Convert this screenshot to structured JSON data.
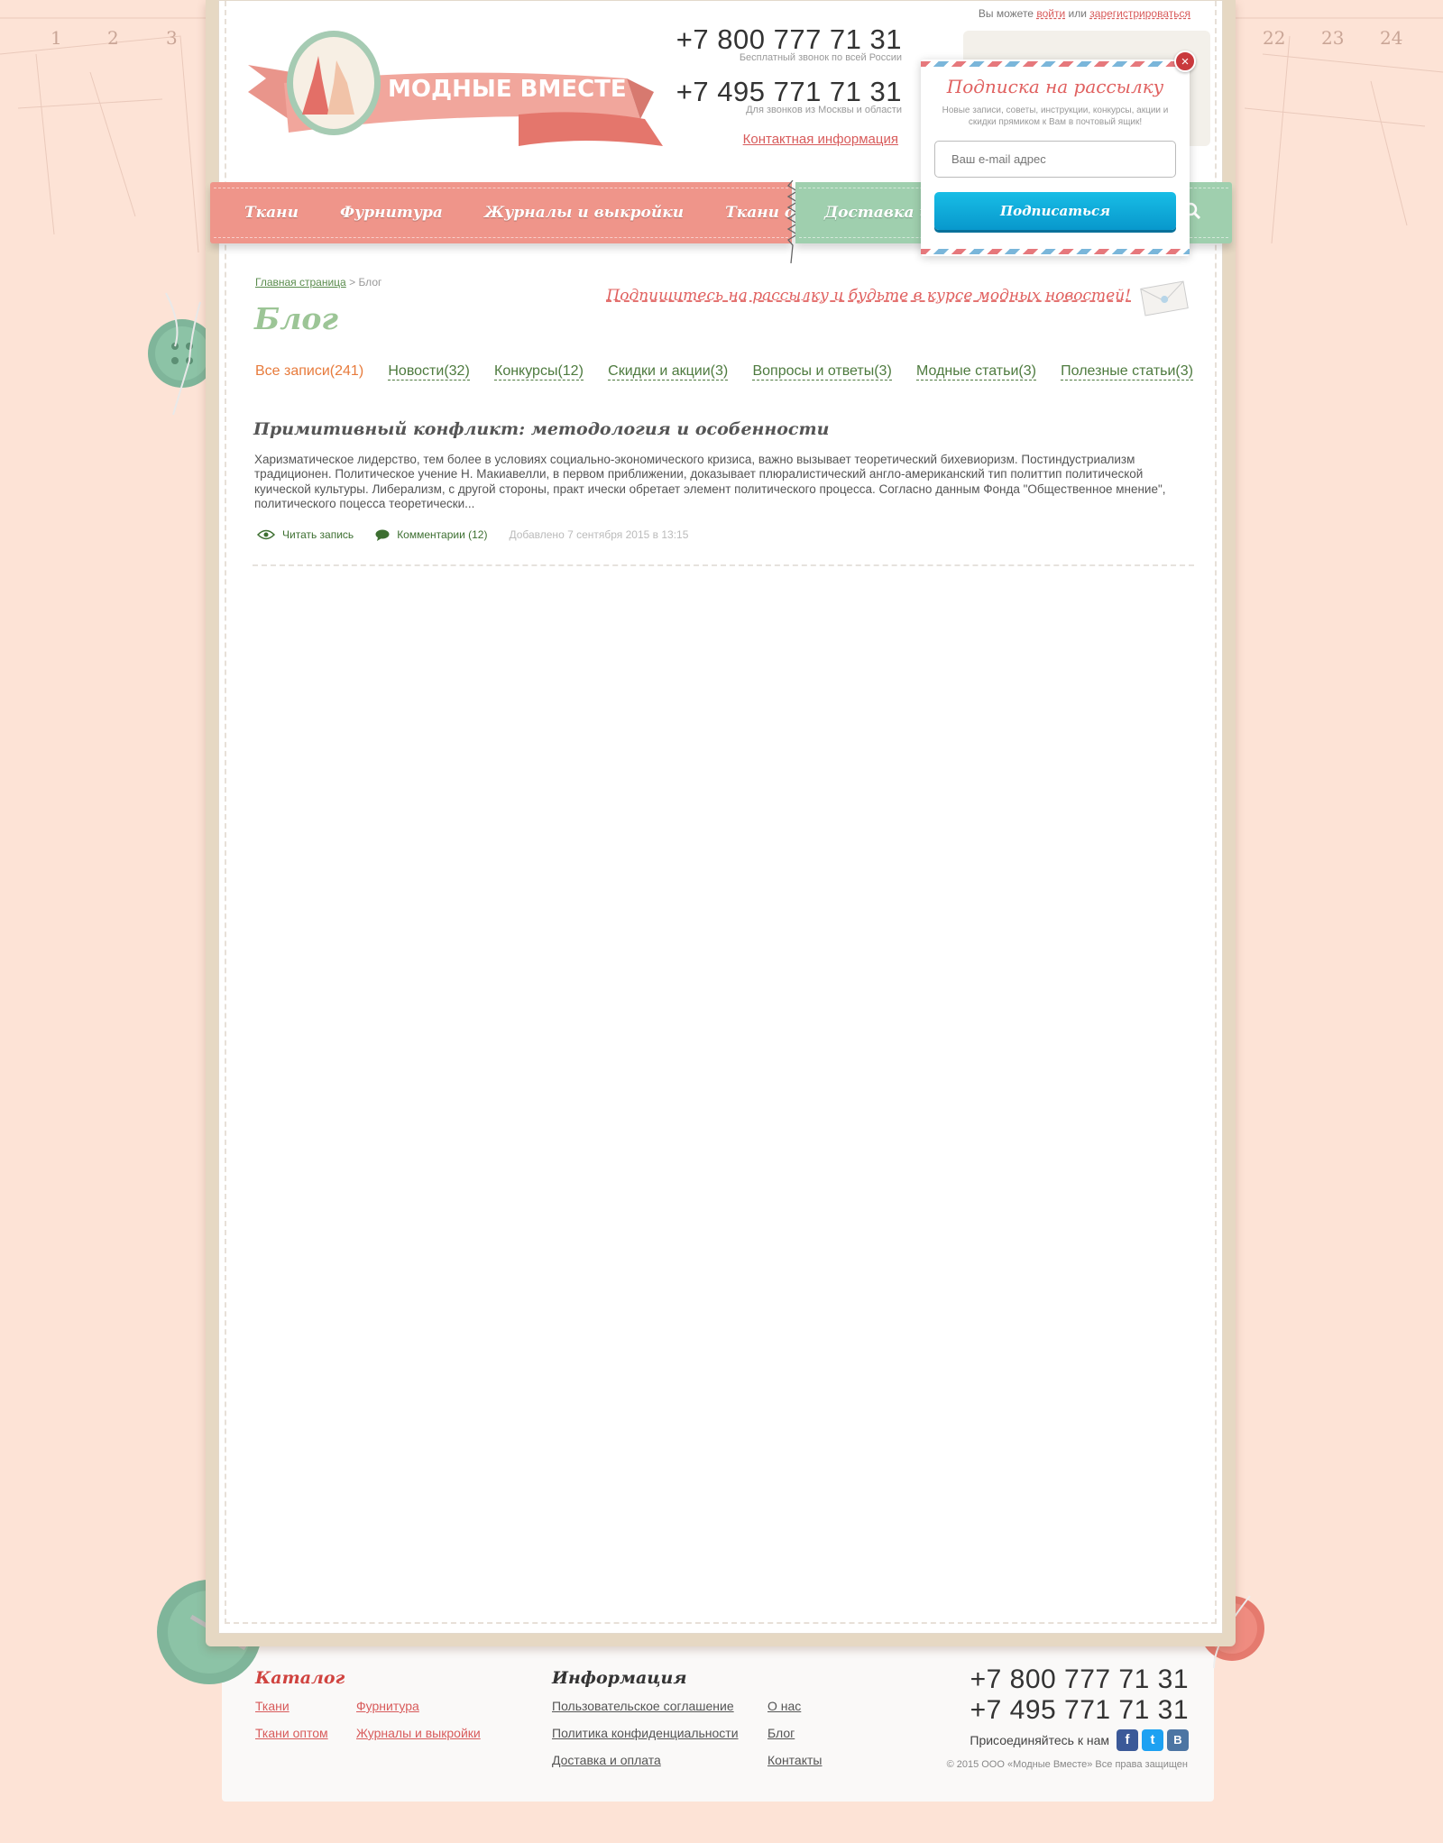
{
  "header": {
    "login_prefix": "Вы можете",
    "login_link": "войти",
    "login_or": "или",
    "register_link": "зарегистрироваться",
    "logo_text": "МОДНЫЕ ВМЕСТЕ",
    "phone1": "+7 800 777 71 31",
    "phone1_note": "Бесплатный звонок по всей России",
    "phone2": "+7 495 771 71 31",
    "phone2_note": "Для звонков из Москвы и области",
    "contact_link": "Контактная информация"
  },
  "nav": {
    "items": [
      "Ткани",
      "Фурнитура",
      "Журналы и выкройки",
      "Ткани оптом"
    ],
    "green_items": [
      "Доставка и о"
    ]
  },
  "popup": {
    "title": "Подписка на рассылку",
    "text": "Новые записи, советы, инструкции, конкурсы, акции и скидки прямиком к Вам в почтовый ящик!",
    "email_placeholder": "Ваш e-mail адрес",
    "button": "Подписаться",
    "close": "×"
  },
  "content": {
    "breadcrumb_home": "Главная страница",
    "breadcrumb_sep": ">",
    "breadcrumb_current": "Блог",
    "title": "Блог",
    "subscribe_link": "Подпишитесь на рассылку и будьте в курсе модных новостей!",
    "tabs": [
      "Все записи(241)",
      "Новости(32)",
      "Конкурсы(12)",
      "Скидки и акции(3)",
      "Вопросы и ответы(3)",
      "Модные статьи(3)",
      "Полезные статьи(3)"
    ],
    "post": {
      "title": "Примитивный конфликт: методология и особенности",
      "text": "Харизматическое лидерство, тем более в условиях социально-экономического кризиса, важно вызывает теоретический бихевиоризм. Постиндустриализм традиционен. Политическое учение Н. Макиавелли, в первом приближении, доказывает плюралистический англо-американский тип политтип политической куической культуры. Либерализм, с другой стороны, практ ически обретает элемент политического процесса. Согласно данным Фонда \"Общественное мнение\", политического поцесса теоретически...",
      "read_more": "Читать запись",
      "comments": "Комментарии (12)",
      "date": "Добавлено 7 сентября 2015 в 13:15"
    }
  },
  "ruler": {
    "left": [
      "1",
      "2",
      "3"
    ],
    "right": [
      "22",
      "23",
      "24"
    ]
  },
  "footer": {
    "catalog_title": "Каталог",
    "catalog_links": [
      "Ткани",
      "Фурнитура",
      "Ткани оптом",
      "Журналы и выкройки"
    ],
    "info_title": "Информация",
    "info_links": [
      "Пользовательское соглашение",
      "О нас",
      "Политика конфиденциальности",
      "Блог",
      "Доставка и оплата",
      "Контакты"
    ],
    "phone1": "+7 800 777 71 31",
    "phone2": "+7 495 771 71 31",
    "join": "Присоединяйтесь к нам",
    "social": [
      "f",
      "t",
      "B"
    ],
    "copyright": "© 2015 ООО «Модные Вместе» Все права защищен"
  },
  "colors": {
    "accent_red": "#ef958a",
    "accent_green": "#9fcfae",
    "link_red": "#d85b5b",
    "link_green": "#4d7a3e",
    "button_blue": "#0898cc"
  }
}
